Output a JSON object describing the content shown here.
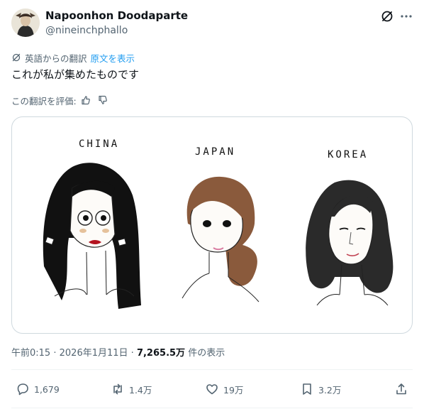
{
  "author": {
    "display_name": "Napoonhon Doodaparte",
    "handle": "@nineinchphallo"
  },
  "translation": {
    "label": "英語からの翻訳",
    "show_original": "原文を表示"
  },
  "tweet_text": "これが私が集めたものです",
  "rate_translation": "この翻訳を評価:",
  "media": {
    "labels": [
      "CHINA",
      "JAPAN",
      "KOREA"
    ]
  },
  "meta": {
    "time": "午前0:15",
    "separator": "·",
    "date": "2026年1月11日",
    "views": "7,265.5万",
    "views_suffix": "件の表示"
  },
  "actions": {
    "replies": "1,679",
    "reposts": "1.4万",
    "likes": "19万",
    "bookmarks": "3.2万"
  },
  "icons": {
    "translate": "translate-icon",
    "grok": "grok-icon",
    "more": "more-icon",
    "reply": "reply-icon",
    "repost": "repost-icon",
    "like": "heart-icon",
    "bookmark": "bookmark-icon",
    "share": "share-icon"
  }
}
